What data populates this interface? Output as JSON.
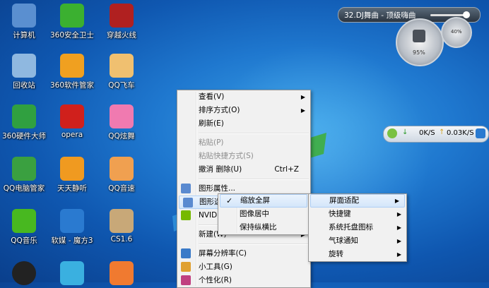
{
  "desktop_icons": [
    {
      "label": "计算机",
      "icon": "computer-icon",
      "color": "#5a8fd0"
    },
    {
      "label": "360安全卫士",
      "icon": "360-guard-icon",
      "color": "#3bb030"
    },
    {
      "label": "穿越火线",
      "icon": "crossfire-icon",
      "color": "#b02020"
    },
    {
      "label": "回收站",
      "icon": "recycle-bin-icon",
      "color": "#8fb8e0"
    },
    {
      "label": "360软件管家",
      "icon": "360-software-icon",
      "color": "#f0a020"
    },
    {
      "label": "QQ飞车",
      "icon": "qq-speed-icon",
      "color": "#f0c070"
    },
    {
      "label": "360硬件大师",
      "icon": "360-hardware-icon",
      "color": "#30a040"
    },
    {
      "label": "opera",
      "icon": "opera-icon",
      "color": "#d0201c"
    },
    {
      "label": "QQ炫舞",
      "icon": "qq-dance-icon",
      "color": "#f07ab0"
    },
    {
      "label": "QQ电脑管家",
      "icon": "qq-pcmgr-icon",
      "color": "#3aa040"
    },
    {
      "label": "天天静听",
      "icon": "ttplayer-icon",
      "color": "#f09a20"
    },
    {
      "label": "QQ音速",
      "icon": "qq-r2beat-icon",
      "color": "#f0a050"
    },
    {
      "label": "QQ音乐",
      "icon": "qq-music-icon",
      "color": "#48b820"
    },
    {
      "label": "软媒 - 魔方3",
      "icon": "rubik-icon",
      "color": "#2a7ad0"
    },
    {
      "label": "CS1.6",
      "icon": "cs-icon",
      "color": "#c8a878"
    }
  ],
  "context_menu": {
    "items": [
      {
        "label": "查看(V)",
        "submenu": true
      },
      {
        "label": "排序方式(O)",
        "submenu": true
      },
      {
        "label": "刷新(E)"
      },
      {
        "sep": true
      },
      {
        "label": "粘贴(P)",
        "disabled": true
      },
      {
        "label": "粘贴快捷方式(S)",
        "disabled": true
      },
      {
        "label": "撤消 删除(U)",
        "accel": "Ctrl+Z"
      },
      {
        "sep": true
      },
      {
        "label": "图形属性...",
        "icon": "graphics-icon"
      },
      {
        "label": "图形选项",
        "submenu": true,
        "icon": "graphics-icon",
        "highlight": true
      },
      {
        "label": "NVIDIA 控制面板",
        "icon": "nvidia-icon"
      },
      {
        "sep": true
      },
      {
        "label": "新建(W)",
        "submenu": true
      },
      {
        "sep": true
      },
      {
        "label": "屏幕分辨率(C)",
        "icon": "display-icon"
      },
      {
        "label": "小工具(G)",
        "icon": "gadget-icon"
      },
      {
        "label": "个性化(R)",
        "icon": "personalize-icon"
      }
    ]
  },
  "submenu_graphics": {
    "items": [
      {
        "label": "缩放全屏",
        "checked": true,
        "highlight": true
      },
      {
        "label": "图像居中"
      },
      {
        "label": "保持纵横比"
      }
    ]
  },
  "submenu_panel": {
    "items": [
      {
        "label": "屏面适配",
        "highlight": true
      },
      {
        "label": "快捷键"
      },
      {
        "label": "系统托盘图标"
      },
      {
        "label": "气球通知"
      },
      {
        "label": "旋转"
      }
    ]
  },
  "music_widget": {
    "title": "32.DJ舞曲 - 顶级嗨曲"
  },
  "gauge": {
    "cpu": "40%",
    "mem": "95%"
  },
  "net_widget": {
    "down": "0K/S",
    "up": "0.03K/S"
  }
}
